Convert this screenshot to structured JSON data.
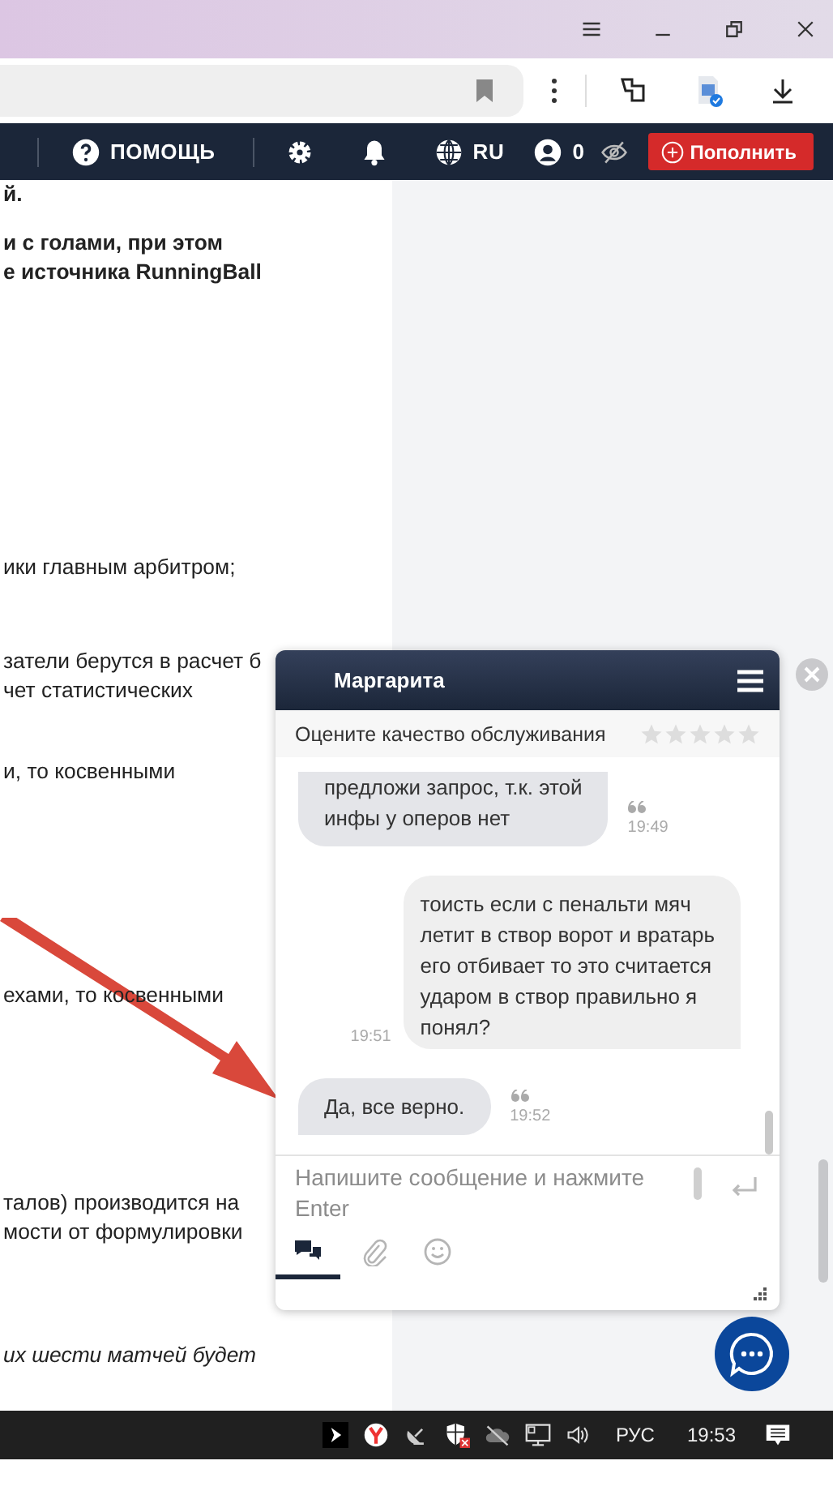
{
  "nav": {
    "help": "ПОМОЩЬ",
    "language": "RU",
    "balance": "0",
    "topup_button": "Пополнить"
  },
  "article": [
    {
      "kind": "bold",
      "lines": [
        "й."
      ]
    },
    {
      "kind": "bold",
      "lines": [
        "и с голами, при этом",
        "е источника RunningBall"
      ]
    },
    {
      "kind": "normal",
      "lines": [
        "ики главным арбитром;"
      ]
    },
    {
      "kind": "normal",
      "lines": [
        "затели берутся в расчет б",
        "чет статистических"
      ]
    },
    {
      "kind": "normal",
      "lines": [
        "и, то косвенными"
      ]
    },
    {
      "kind": "normal",
      "lines": [
        "ехами, то косвенными"
      ]
    },
    {
      "kind": "normal",
      "lines": [
        "талов) производится на",
        "мости от формулировки"
      ]
    },
    {
      "kind": "italic",
      "lines": [
        "их шести матчей будет"
      ]
    }
  ],
  "chat": {
    "agent": "Маргарита",
    "rating": {
      "label": "Оцените качество обслуживания",
      "stars": 0
    },
    "messages": [
      {
        "kind": "operator",
        "text": "предложи запрос, т.к. этой\nинфы у оперов нет",
        "time": "19:49",
        "cut_top": true
      },
      {
        "kind": "user",
        "text": "тоисть если с пенальти мяч\nлетит в створ ворот и вратарь\nего отбивает то это считается\nударом в створ правильно я\nпонял?",
        "time": "19:51",
        "cut_top": false
      },
      {
        "kind": "operator",
        "text": "Да, все верно.",
        "time": "19:52",
        "cut_top": false
      }
    ],
    "input": {
      "placeholder": "Напишите сообщение и нажмите Enter"
    },
    "tabs": [
      {
        "kind": "chat",
        "selected": true
      },
      {
        "kind": "attach",
        "selected": false
      },
      {
        "kind": "emoji",
        "selected": false
      }
    ]
  },
  "taskbar": {
    "language": "РУС",
    "time": "19:53"
  }
}
